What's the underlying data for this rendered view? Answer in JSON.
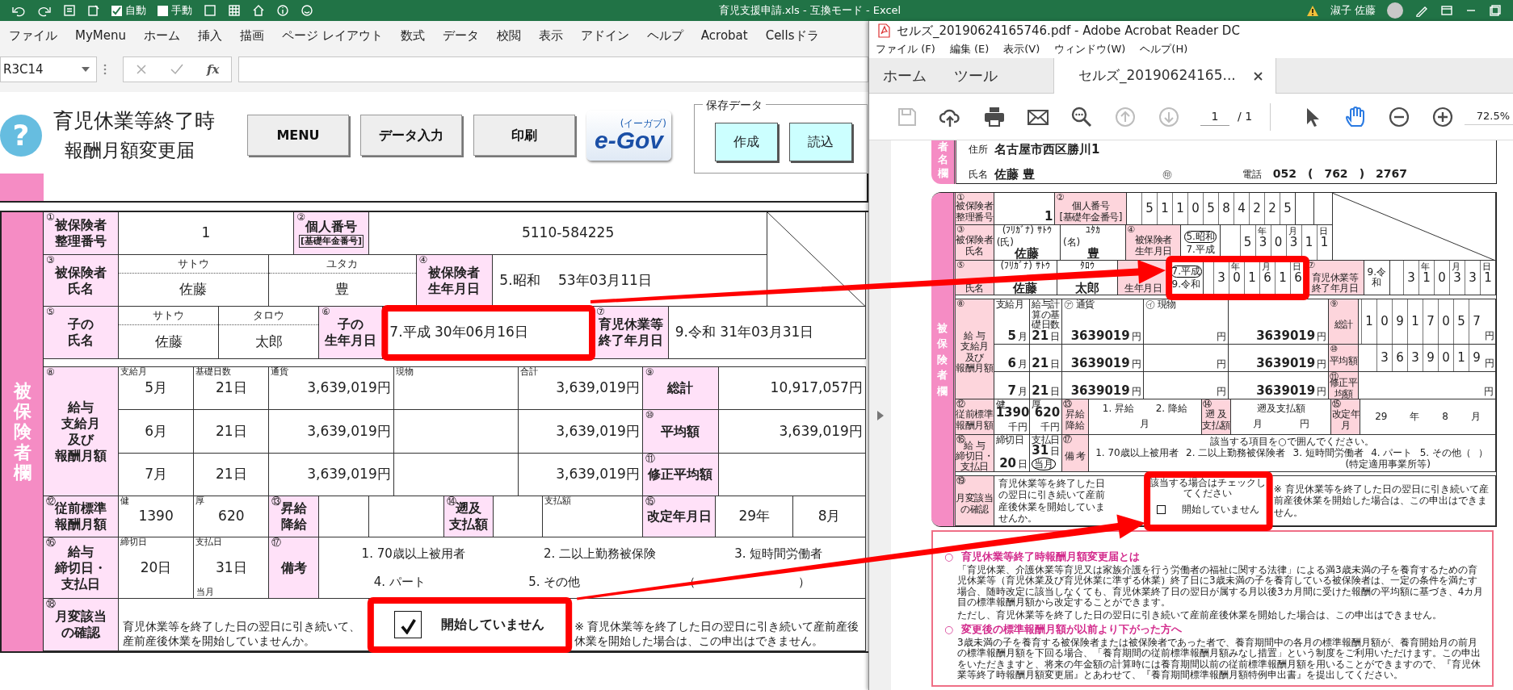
{
  "excel": {
    "title_bar": {
      "autosave": [
        {
          "label": "自動",
          "checked": true
        },
        {
          "label": "手動",
          "checked": false
        }
      ],
      "title": "育児支援申請.xls - 互換モード - Excel",
      "user": "淑子 佐藤"
    },
    "ribbon_tabs": [
      "ファイル",
      "MyMenu",
      "ホーム",
      "挿入",
      "描画",
      "ページ レイアウト",
      "数式",
      "データ",
      "校閲",
      "表示",
      "アドイン",
      "ヘルプ",
      "Acrobat",
      "Cellsドラ"
    ],
    "formula_bar": {
      "name_box": "R3C14",
      "fx": "fx"
    },
    "sheet_header": {
      "help_icon": "?",
      "title_lines": [
        "育児休業等終了時",
        "報酬月額変更届"
      ],
      "buttons": [
        "MENU",
        "データ入力",
        "印刷"
      ],
      "logo": {
        "main": "e-Gov",
        "sub": "(イーガブ)"
      },
      "save_group": {
        "legend": "保存データ",
        "buttons": [
          "作成",
          "読込"
        ]
      }
    },
    "form": {
      "side_label": "被保険者欄",
      "sections": [
        {
          "label": {
            "num": "①",
            "lines": [
              "被保険者",
              "整理番号"
            ]
          },
          "rows": [
            [
              {
                "kind": "value",
                "text": "1"
              },
              {
                "kind": "label",
                "num": "②",
                "lines": [
                  "個人番号"
                ],
                "sub": "[基礎年金番号]"
              },
              {
                "kind": "value",
                "text": "5110-584225"
              }
            ]
          ]
        },
        {
          "label": {
            "num": "③",
            "lines": [
              "被保険者",
              "氏名"
            ]
          },
          "rows": [
            [
              {
                "kind": "name",
                "furigana": "サトウ",
                "text": "佐藤"
              },
              {
                "kind": "name",
                "furigana": "ユタカ",
                "text": "豊"
              },
              {
                "kind": "label",
                "num": "④",
                "lines": [
                  "被保険者",
                  "生年月日"
                ]
              },
              {
                "kind": "date",
                "text": "5.昭和　 53年03月11日"
              }
            ]
          ]
        },
        {
          "label": {
            "num": "⑤",
            "lines": [
              "子の",
              "氏名"
            ]
          },
          "rows": [
            [
              {
                "kind": "name",
                "furigana": "サトウ",
                "text": "佐藤"
              },
              {
                "kind": "name",
                "furigana": "タロウ",
                "text": "太郎"
              },
              {
                "kind": "label",
                "num": "⑥",
                "lines": [
                  "子の",
                  "生年月日"
                ]
              },
              {
                "kind": "date",
                "text": "7.平成  30年06月16日",
                "highlighted": true
              },
              {
                "kind": "label",
                "num": "⑦",
                "lines": [
                  "育児休業等",
                  "終了年月日"
                ]
              },
              {
                "kind": "date",
                "text": "9.令和  31年03月31日"
              }
            ]
          ]
        },
        {
          "label": {
            "num": "⑧",
            "lines": [
              "給与",
              "支給月",
              "及び",
              "報酬月額"
            ]
          },
          "rows": [
            [
              {
                "kind": "value",
                "caption": "支給月",
                "text": "5月"
              },
              {
                "kind": "value",
                "caption": "基礎日数",
                "text": "21日"
              },
              {
                "kind": "amount",
                "caption": "通貨",
                "text": "3,639,019円"
              },
              {
                "kind": "amount",
                "caption": "現物"
              },
              {
                "kind": "amount",
                "caption": "合計",
                "text": "3,639,019円"
              },
              {
                "kind": "label",
                "num": "⑨",
                "lines": [
                  "総計"
                ]
              },
              {
                "kind": "amount",
                "text": "10,917,057円"
              }
            ],
            [
              {
                "kind": "value",
                "text": "6月"
              },
              {
                "kind": "value",
                "text": "21日"
              },
              {
                "kind": "amount",
                "text": "3,639,019円"
              },
              {
                "kind": "blank"
              },
              {
                "kind": "amount",
                "text": "3,639,019円"
              },
              {
                "kind": "label",
                "num": "⑩",
                "lines": [
                  "平均額"
                ]
              },
              {
                "kind": "amount",
                "text": "3,639,019円"
              }
            ],
            [
              {
                "kind": "value",
                "text": "7月"
              },
              {
                "kind": "value",
                "text": "21日"
              },
              {
                "kind": "amount",
                "text": "3,639,019円"
              },
              {
                "kind": "blank"
              },
              {
                "kind": "amount",
                "text": "3,639,019円"
              },
              {
                "kind": "label",
                "num": "⑪",
                "lines": [
                  "修正平均額"
                ]
              },
              {
                "kind": "blank"
              }
            ]
          ]
        },
        {
          "label": {
            "num": "⑫",
            "lines": [
              "従前標準",
              "報酬月額"
            ]
          },
          "rows": [
            [
              {
                "kind": "value",
                "caption": "健",
                "text": "1390"
              },
              {
                "kind": "value",
                "caption": "厚",
                "text": "620"
              },
              {
                "kind": "label",
                "num": "⑬",
                "lines": [
                  "昇給",
                  "降給"
                ]
              },
              {
                "kind": "blank"
              },
              {
                "kind": "blank"
              },
              {
                "kind": "label",
                "num": "⑭",
                "lines": [
                  "遡及",
                  "支払額"
                ]
              },
              {
                "kind": "blank"
              },
              {
                "kind": "amount",
                "caption": "支払額"
              },
              {
                "kind": "label",
                "num": "⑮",
                "lines": [
                  "改定年月日"
                ]
              },
              {
                "kind": "value",
                "text": "29年"
              },
              {
                "kind": "value",
                "text": "8月"
              }
            ]
          ]
        },
        {
          "label": {
            "num": "⑯",
            "lines": [
              "給与",
              "締切日・",
              "支払日"
            ]
          },
          "rows": [
            [
              {
                "kind": "value",
                "caption": "締切日",
                "text": "20日"
              },
              {
                "kind": "value",
                "caption": "支払日",
                "text": "31日",
                "sub": "当月"
              },
              {
                "kind": "label",
                "num": "⑰",
                "lines": [
                  "備考"
                ]
              },
              {
                "kind": "remarks",
                "lines": [
                  [
                    "1. 70歳以上被用者",
                    "2. 二以上勤務被保険",
                    "3. 短時間労働者"
                  ],
                  [
                    "4. パート",
                    "5. その他",
                    "（",
                    "）"
                  ]
                ]
              }
            ]
          ]
        },
        {
          "label": {
            "num": "⑱",
            "lines": [
              "月変該当",
              "の確認"
            ]
          },
          "rows": [
            [
              {
                "kind": "note",
                "lines": [
                  "育児休業等を終了した日の翌日に引き続いて、",
                  "産前産後休業を開始していませんか。"
                ]
              },
              {
                "kind": "check",
                "checked": true,
                "text": "開始していません",
                "highlighted": true
              },
              {
                "kind": "note",
                "lines": [
                  "※ 育児休業等を終了した日の翌日に引き続いて産前産後休業を開始した場合は、この申出はできません。"
                ]
              }
            ]
          ]
        }
      ]
    }
  },
  "acrobat": {
    "title": "セルズ_20190624165746.pdf - Adobe Acrobat Reader DC",
    "menu": [
      "ファイル (F)",
      "編集 (E)",
      "表示(V)",
      "ウィンドウ(W)",
      "ヘルプ(H)"
    ],
    "tabs": [
      {
        "label": "ホーム",
        "selected": false,
        "closable": false
      },
      {
        "label": "ツール",
        "selected": false,
        "closable": false
      },
      {
        "label": "セルズ_20190624165...",
        "selected": true,
        "closable": true
      }
    ],
    "toolbar": {
      "file_tools": [
        {
          "disabled": true
        },
        {
          "disabled": false
        },
        {
          "disabled": false
        },
        {
          "disabled": false
        },
        {
          "disabled": false
        },
        {
          "disabled": true
        },
        {
          "disabled": true
        }
      ],
      "page": "1",
      "page_total": "/ 1",
      "view_tools": [
        {
          "selected": false
        },
        {
          "selected": true
        },
        {
          "selected": false
        },
        {
          "selected": false
        }
      ],
      "zoom": "72.5%"
    },
    "document": {
      "applicant": {
        "side_label": "者名欄",
        "address_label": "住所",
        "address": "名古屋市西区勝川1",
        "name_label": "氏名",
        "name": "佐藤 豊",
        "seal": "㊞",
        "phone_label": "電話",
        "phone": [
          "052",
          "(",
          "762",
          ")",
          "2767"
        ]
      },
      "form": {
        "side_label": "被保険者欄",
        "sections": [
          {
            "label": {
              "num": "①",
              "lines": [
                "被保険者",
                "整理番号"
              ]
            },
            "rows": [
              [
                {
                  "kind": "value",
                  "text": "1"
                },
                {
                  "kind": "label",
                  "num": "②",
                  "lines": [
                    "個人番号"
                  ],
                  "sub": "[基礎年金番号]"
                },
                {
                  "kind": "digits",
                  "digits": [
                    "5",
                    "1",
                    "1",
                    "0",
                    "5",
                    "8",
                    "4",
                    "2",
                    "2",
                    "5"
                  ]
                },
                {
                  "kind": "blank"
                },
                {
                  "kind": "blank"
                }
              ]
            ]
          },
          {
            "label": {
              "num": "③",
              "lines": [
                "被保険者",
                "氏名"
              ]
            },
            "rows": [
              [
                {
                  "kind": "name",
                  "furigana": "(ﾌﾘｶﾞﾅ) ｻﾄｳ",
                  "caption": "(氏)",
                  "text": "佐藤"
                },
                {
                  "kind": "name",
                  "furigana": "ﾕﾀｶ",
                  "caption": "(名)",
                  "text": "豊"
                },
                {
                  "kind": "label",
                  "num": "④",
                  "lines": [
                    "被保険者",
                    "生年月日"
                  ]
                },
                {
                  "kind": "era",
                  "options": [
                    {
                      "label": "5.昭和",
                      "selected": true
                    },
                    {
                      "label": "7.平成",
                      "selected": false
                    }
                  ]
                },
                {
                  "kind": "digits",
                  "digits": [
                    "5",
                    "3",
                    "0",
                    "3",
                    "1",
                    "1"
                  ],
                  "marks": [
                    "年",
                    "月",
                    "日"
                  ]
                }
              ]
            ]
          },
          {
            "label": {
              "num": "⑤",
              "lines": [
                "氏名"
              ]
            },
            "rows": [
              [
                {
                  "kind": "name",
                  "furigana": "(ﾌﾘｶﾞﾅ) ｻﾄｳ",
                  "text": "佐藤"
                },
                {
                  "kind": "name",
                  "furigana": "ﾀﾛｳ",
                  "text": "太郎"
                },
                {
                  "kind": "label",
                  "lines": [
                    "生年月日"
                  ]
                },
                {
                  "kind": "era",
                  "options": [
                    {
                      "label": "7.平成",
                      "selected": true
                    },
                    {
                      "label": "9.令和",
                      "selected": false
                    }
                  ],
                  "highlighted": true
                },
                {
                  "kind": "digits",
                  "digits": [
                    "3",
                    "0",
                    "1",
                    "6",
                    "1",
                    "6"
                  ],
                  "marks": [
                    "年",
                    "月",
                    "日"
                  ],
                  "highlighted": true
                },
                {
                  "kind": "label",
                  "num": "⑦",
                  "lines": [
                    "育児休業等",
                    "終了年月日"
                  ]
                },
                {
                  "kind": "era",
                  "options": [
                    {
                      "label": "9.令和",
                      "selected": false
                    }
                  ]
                },
                {
                  "kind": "digits",
                  "digits": [
                    "3",
                    "1",
                    "0",
                    "3",
                    "3",
                    "1"
                  ],
                  "marks": [
                    "年",
                    "月",
                    "日"
                  ]
                }
              ]
            ]
          },
          {
            "label": {
              "num": "⑧",
              "lines": [
                "給 与",
                "支給月",
                "及び",
                "報酬月額"
              ]
            },
            "rows": [
              [
                {
                  "kind": "value",
                  "caption": "支給月",
                  "text": "5",
                  "unit": "月"
                },
                {
                  "kind": "value",
                  "caption": "給与計算の基礎日数",
                  "text": "21",
                  "unit": "日"
                },
                {
                  "kind": "amount",
                  "caption": "㋐ 通貨",
                  "text": "3639019",
                  "unit": "円"
                },
                {
                  "kind": "amount",
                  "caption": "㋑ 現物",
                  "unit": "円"
                },
                {
                  "kind": "amount",
                  "text": "3639019",
                  "unit": "円"
                },
                {
                  "kind": "label",
                  "num": "⑨",
                  "lines": [
                    "総計"
                  ]
                },
                {
                  "kind": "digits",
                  "digits": [
                    "1",
                    "0",
                    "9",
                    "1",
                    "7",
                    "0",
                    "5",
                    "7"
                  ],
                  "unit": "円"
                }
              ],
              [
                {
                  "kind": "value",
                  "text": "6",
                  "unit": "月"
                },
                {
                  "kind": "value",
                  "text": "21",
                  "unit": "日"
                },
                {
                  "kind": "amount",
                  "text": "3639019",
                  "unit": "円"
                },
                {
                  "kind": "amount",
                  "unit": "円"
                },
                {
                  "kind": "amount",
                  "text": "3639019",
                  "unit": "円"
                },
                {
                  "kind": "label",
                  "num": "⑩",
                  "lines": [
                    "平均額"
                  ]
                },
                {
                  "kind": "digits",
                  "digits": [
                    "3",
                    "6",
                    "3",
                    "9",
                    "0",
                    "1",
                    "9"
                  ],
                  "unit": "円"
                }
              ],
              [
                {
                  "kind": "value",
                  "text": "7",
                  "unit": "月"
                },
                {
                  "kind": "value",
                  "text": "21",
                  "unit": "日"
                },
                {
                  "kind": "amount",
                  "text": "3639019",
                  "unit": "円"
                },
                {
                  "kind": "amount",
                  "unit": "円"
                },
                {
                  "kind": "amount",
                  "text": "3639019",
                  "unit": "円"
                },
                {
                  "kind": "label",
                  "num": "⑪",
                  "lines": [
                    "修正平均額"
                  ]
                },
                {
                  "kind": "amount",
                  "unit": "円"
                }
              ]
            ]
          },
          {
            "label": {
              "num": "⑫",
              "lines": [
                "従前標準",
                "報酬月額"
              ]
            },
            "rows": [
              [
                {
                  "kind": "value",
                  "caption": "健",
                  "text": "1390",
                  "unit": "千円"
                },
                {
                  "kind": "value",
                  "caption": "厚",
                  "text": "620",
                  "unit": "千円"
                },
                {
                  "kind": "label",
                  "num": "⑬",
                  "lines": [
                    "昇給",
                    "降給"
                  ]
                },
                {
                  "kind": "remarks",
                  "lines": [
                    [
                      "1. 昇給",
                      "2. 降給"
                    ],
                    [
                      "月"
                    ]
                  ]
                },
                {
                  "kind": "label",
                  "num": "⑭",
                  "lines": [
                    "遡 及",
                    "支払額"
                  ]
                },
                {
                  "kind": "remarks",
                  "lines": [
                    [
                      "遡及支払額"
                    ],
                    [
                      "月",
                      "円"
                    ]
                  ]
                },
                {
                  "kind": "label",
                  "num": "⑮",
                  "lines": [
                    "改定年月"
                  ]
                },
                {
                  "kind": "remarks",
                  "lines": [
                    [
                      "29",
                      "年",
                      "8",
                      "月"
                    ]
                  ]
                }
              ]
            ]
          },
          {
            "label": {
              "num": "⑯",
              "lines": [
                "給 与",
                "締切日・",
                "支払日"
              ]
            },
            "rows": [
              [
                {
                  "kind": "value",
                  "caption": "締切日",
                  "text": "20",
                  "unit": "日"
                },
                {
                  "kind": "value",
                  "caption": "支払日",
                  "text": "31",
                  "sub": "当月",
                  "sub_selected": true,
                  "unit": "日"
                },
                {
                  "kind": "label",
                  "num": "⑰",
                  "lines": [
                    "備 考"
                  ]
                },
                {
                  "kind": "remarks",
                  "lines": [
                    [
                      "該当する項目を○で囲んでください。"
                    ],
                    [
                      "1. 70歳以上被用者",
                      "2. 二以上勤務被保険者",
                      "3. 短時間労働者",
                      "4. パート",
                      "5. その他（",
                      "）"
                    ],
                    [
                      "(特定適用事業所等)"
                    ]
                  ]
                }
              ]
            ]
          },
          {
            "label": {
              "num": "⑲",
              "lines": [
                "月変該当",
                "の確認"
              ]
            },
            "rows": [
              [
                {
                  "kind": "note",
                  "lines": [
                    "育児休業等を終了した日の翌日に引き続いて産前産後休業を開始していませんか。"
                  ]
                },
                {
                  "kind": "check",
                  "caption": "該当する場合はチェックしてください",
                  "checked": false,
                  "text": "開始していません",
                  "highlighted": true
                },
                {
                  "kind": "note",
                  "lines": [
                    "※ 育児休業等を終了した日の翌日に引き続いて産前産後休業を開始した場合は、この申出はできません。"
                  ]
                }
              ]
            ]
          }
        ]
      },
      "notice": {
        "blocks": [
          {
            "marker": "○",
            "heading": "育児休業等終了時報酬月額変更届とは",
            "paragraphs": [
              "「育児休業、介護休業等育児又は家族介護を行う労働者の福祉に関する法律」による満3歳未満の子を養育するための育児休業等（育児休業及び育児休業に準ずる休業）終了日に3歳未満の子を養育している被保険者は、一定の条件を満たす場合、随時改定に該当しなくても、育児休業終了日の翌日が属する月以後3カ月間に受けた報酬の平均額に基づき、4カ月目の標準報酬月額から改定することができます。",
              "ただし、育児休業等を終了した日の翌日に引き続いて産前産後休業を開始した場合は、この申出はできません。"
            ]
          },
          {
            "marker": "○",
            "heading": "変更後の標準報酬月額が以前より下がった方へ",
            "paragraphs": [
              "3歳未満の子を養育する被保険者または被保険者であった者で、養育期間中の各月の標準報酬月額が、養育開始月の前月の標準報酬月額を下回る場合、「養育期間の従前標準報酬月額みなし措置」という制度をご利用いただけます。この申出をいただきますと、将来の年金額の計算時には養育期間以前の従前標準報酬月額を用いることができますので、『育児休業等終了時報酬月額変更届』とあわせて、『養育期間標準報酬月額特例申出書』を提出してください。"
            ]
          }
        ]
      }
    }
  }
}
